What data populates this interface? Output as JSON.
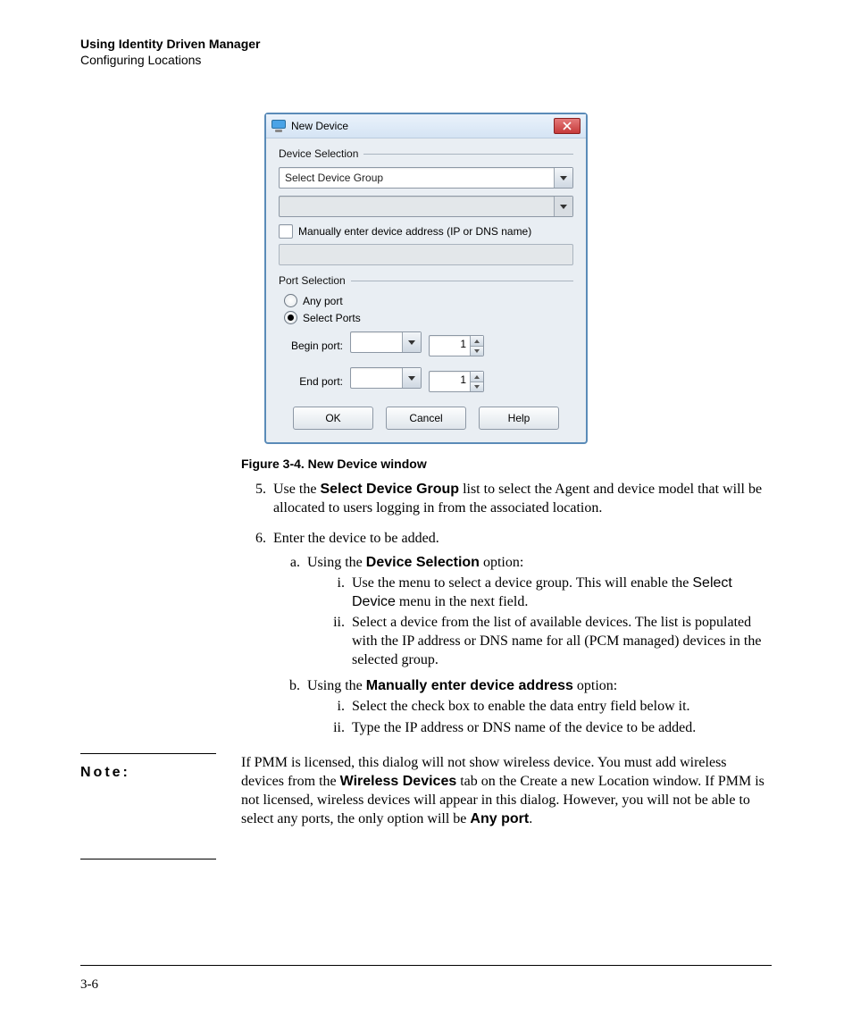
{
  "header": {
    "title": "Using Identity Driven Manager",
    "subtitle": "Configuring Locations"
  },
  "dialog": {
    "title": "New Device",
    "device_selection_label": "Device Selection",
    "device_group_value": "Select Device Group",
    "manual_checkbox_label": "Manually enter device address (IP or DNS name)",
    "port_selection_label": "Port Selection",
    "any_port_label": "Any port",
    "select_ports_label": "Select Ports",
    "begin_port_label": "Begin port:",
    "end_port_label": "End port:",
    "begin_port_value": "1",
    "end_port_value": "1",
    "ok_label": "OK",
    "cancel_label": "Cancel",
    "help_label": "Help"
  },
  "caption": "Figure 3-4. New Device window",
  "step5": {
    "pre": "Use the ",
    "bold": "Select Device Group",
    "post": " list to select the Agent and device model that will be allocated to users logging in from the associated location."
  },
  "step6": {
    "intro": "Enter the device to be added.",
    "a": {
      "pre": "Using the ",
      "bold": "Device Selection",
      "post": " option:"
    },
    "a_i": {
      "pre": "Use the menu to select a device group. This will enable the ",
      "code": "Select Device",
      "post": " menu in the next field."
    },
    "a_ii": "Select a device from the list of available devices. The list is populated with the IP address or DNS name for all (PCM managed) devices in the selected group.",
    "b": {
      "pre": "Using the ",
      "bold": "Manually enter device address",
      "post": " option:"
    },
    "b_i": "Select the check box to enable the data entry field below it.",
    "b_ii": "Type the IP address or DNS name of the device to be added."
  },
  "note": {
    "label": "Note:",
    "t1": "If PMM is licensed, this dialog will not show wireless device. You must add wireless devices from the ",
    "b1": "Wireless Devices",
    "t2": " tab on the Create a new Location window. If PMM is not licensed, wireless devices will appear in this dialog. However, you will not be able to select any ports, the only option will be ",
    "b2": "Any port",
    "t3": "."
  },
  "page_number": "3-6"
}
